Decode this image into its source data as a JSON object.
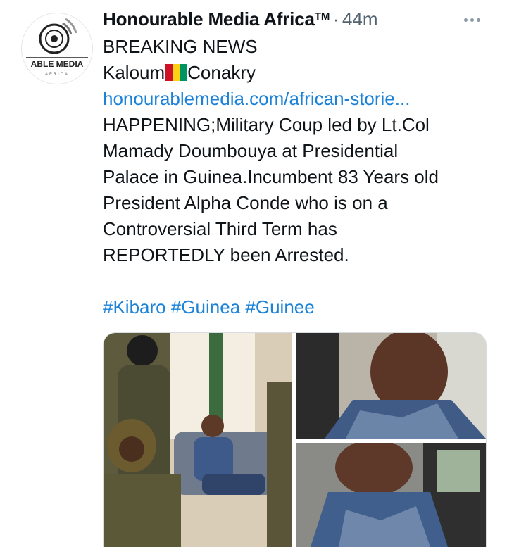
{
  "tweet": {
    "author_name": "Honourable Media Africa",
    "trademark": "TM",
    "separator": "·",
    "timestamp": "44m",
    "avatar_logo_text": "ABLE MEDIA",
    "avatar_logo_subtext": "AFRICA",
    "more_icon": "ellipsis-icon",
    "lines": {
      "breaking": "BREAKING NEWS",
      "location_left": "Kaloum",
      "location_right": "Conakry",
      "link": "honourablemedia.com/african-storie...",
      "body": [
        "HAPPENING;Military Coup led by Lt.Col",
        "Mamady Doumbouya at Presidential",
        "Palace in Guinea.Incumbent 83 Years old",
        "President Alpha Conde who is on a",
        "Controversial Third Term has",
        "REPORTEDLY been Arrested."
      ]
    },
    "flag_colors": [
      "#ce1126",
      "#fcd116",
      "#009460"
    ],
    "hashtags": [
      "#Kibaro",
      "#Guinea",
      "#Guinee"
    ],
    "link_color": "#1b82d8"
  }
}
